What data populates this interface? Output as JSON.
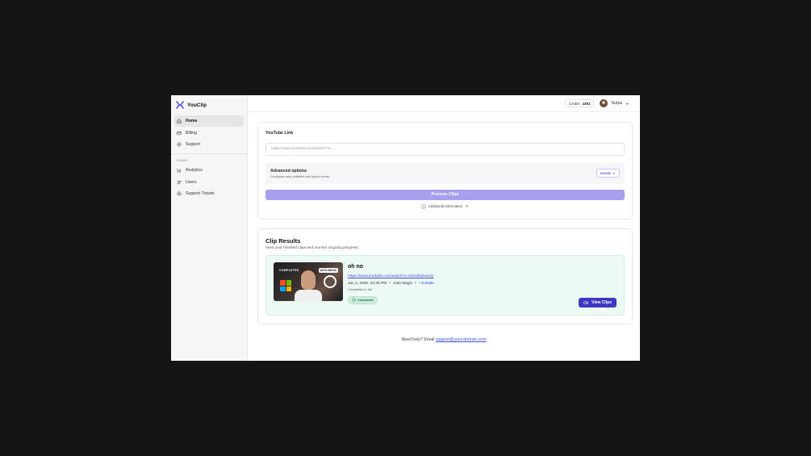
{
  "app": {
    "name": "YouClip"
  },
  "sidebar": {
    "items": [
      {
        "label": "Home",
        "icon": "home-icon",
        "active": true
      },
      {
        "label": "Billing",
        "icon": "credit-card-icon"
      },
      {
        "label": "Support",
        "icon": "lifebuoy-icon"
      }
    ],
    "admin_label": "ADMIN",
    "admin_items": [
      {
        "label": "Analytics",
        "icon": "bar-chart-icon"
      },
      {
        "label": "Users",
        "icon": "users-icon"
      },
      {
        "label": "Support Tickets",
        "icon": "lifebuoy-icon"
      }
    ]
  },
  "header": {
    "credits_label": "Credits",
    "credits_value": "2251",
    "user_name": "Surya"
  },
  "form": {
    "youtube_label": "YouTube Link",
    "youtube_placeholder": "https://www.youtube.com/watch?v=...",
    "advanced_title": "Advanced options",
    "advanced_subtitle": "Configure auto-subtitles and layout mode.",
    "show_label": "SHOW",
    "process_label": "Process Clips",
    "additional_label": "Additional information"
  },
  "results": {
    "title": "Clip Results",
    "subtitle": "View your finished clips and monitor ongoing progress.",
    "clip": {
      "thumb_text_left": "COMPLETED",
      "thumb_text_right": "AUTO MAGIC",
      "title": "oh no",
      "url": "https://www.youtube.com/watch?v=vZeohkGuevQ",
      "date": "Jan 2, 2026, 03:35 PM",
      "mode": "Auto Magic",
      "subtitle_flag": "Subtitle",
      "completed_in": "Completed in 3m",
      "status": "Completed",
      "view_label": "View Clips"
    }
  },
  "footer": {
    "text": "Need help? Email",
    "email": "support@your-domain.com"
  },
  "colors": {
    "accent": "#3d37c4",
    "accent_light": "#a59fed",
    "success_bg": "#edf9f4",
    "link": "#3b52d9"
  }
}
